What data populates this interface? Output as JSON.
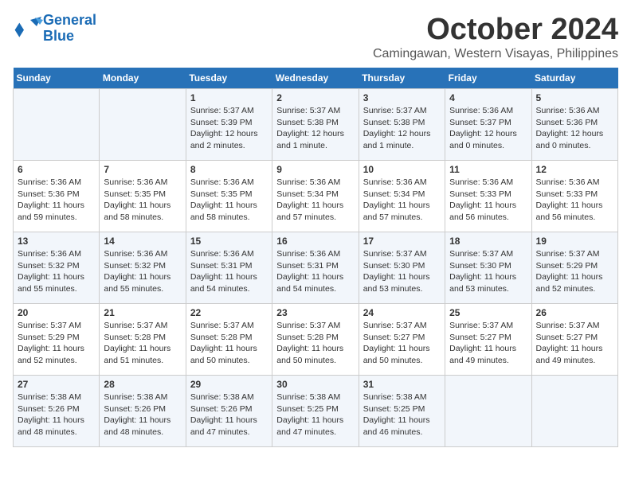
{
  "logo": {
    "line1": "General",
    "line2": "Blue"
  },
  "title": "October 2024",
  "subtitle": "Camingawan, Western Visayas, Philippines",
  "days_header": [
    "Sunday",
    "Monday",
    "Tuesday",
    "Wednesday",
    "Thursday",
    "Friday",
    "Saturday"
  ],
  "weeks": [
    [
      {
        "day": "",
        "info": ""
      },
      {
        "day": "",
        "info": ""
      },
      {
        "day": "1",
        "info": "Sunrise: 5:37 AM\nSunset: 5:39 PM\nDaylight: 12 hours\nand 2 minutes."
      },
      {
        "day": "2",
        "info": "Sunrise: 5:37 AM\nSunset: 5:38 PM\nDaylight: 12 hours\nand 1 minute."
      },
      {
        "day": "3",
        "info": "Sunrise: 5:37 AM\nSunset: 5:38 PM\nDaylight: 12 hours\nand 1 minute."
      },
      {
        "day": "4",
        "info": "Sunrise: 5:36 AM\nSunset: 5:37 PM\nDaylight: 12 hours\nand 0 minutes."
      },
      {
        "day": "5",
        "info": "Sunrise: 5:36 AM\nSunset: 5:36 PM\nDaylight: 12 hours\nand 0 minutes."
      }
    ],
    [
      {
        "day": "6",
        "info": "Sunrise: 5:36 AM\nSunset: 5:36 PM\nDaylight: 11 hours\nand 59 minutes."
      },
      {
        "day": "7",
        "info": "Sunrise: 5:36 AM\nSunset: 5:35 PM\nDaylight: 11 hours\nand 58 minutes."
      },
      {
        "day": "8",
        "info": "Sunrise: 5:36 AM\nSunset: 5:35 PM\nDaylight: 11 hours\nand 58 minutes."
      },
      {
        "day": "9",
        "info": "Sunrise: 5:36 AM\nSunset: 5:34 PM\nDaylight: 11 hours\nand 57 minutes."
      },
      {
        "day": "10",
        "info": "Sunrise: 5:36 AM\nSunset: 5:34 PM\nDaylight: 11 hours\nand 57 minutes."
      },
      {
        "day": "11",
        "info": "Sunrise: 5:36 AM\nSunset: 5:33 PM\nDaylight: 11 hours\nand 56 minutes."
      },
      {
        "day": "12",
        "info": "Sunrise: 5:36 AM\nSunset: 5:33 PM\nDaylight: 11 hours\nand 56 minutes."
      }
    ],
    [
      {
        "day": "13",
        "info": "Sunrise: 5:36 AM\nSunset: 5:32 PM\nDaylight: 11 hours\nand 55 minutes."
      },
      {
        "day": "14",
        "info": "Sunrise: 5:36 AM\nSunset: 5:32 PM\nDaylight: 11 hours\nand 55 minutes."
      },
      {
        "day": "15",
        "info": "Sunrise: 5:36 AM\nSunset: 5:31 PM\nDaylight: 11 hours\nand 54 minutes."
      },
      {
        "day": "16",
        "info": "Sunrise: 5:36 AM\nSunset: 5:31 PM\nDaylight: 11 hours\nand 54 minutes."
      },
      {
        "day": "17",
        "info": "Sunrise: 5:37 AM\nSunset: 5:30 PM\nDaylight: 11 hours\nand 53 minutes."
      },
      {
        "day": "18",
        "info": "Sunrise: 5:37 AM\nSunset: 5:30 PM\nDaylight: 11 hours\nand 53 minutes."
      },
      {
        "day": "19",
        "info": "Sunrise: 5:37 AM\nSunset: 5:29 PM\nDaylight: 11 hours\nand 52 minutes."
      }
    ],
    [
      {
        "day": "20",
        "info": "Sunrise: 5:37 AM\nSunset: 5:29 PM\nDaylight: 11 hours\nand 52 minutes."
      },
      {
        "day": "21",
        "info": "Sunrise: 5:37 AM\nSunset: 5:28 PM\nDaylight: 11 hours\nand 51 minutes."
      },
      {
        "day": "22",
        "info": "Sunrise: 5:37 AM\nSunset: 5:28 PM\nDaylight: 11 hours\nand 50 minutes."
      },
      {
        "day": "23",
        "info": "Sunrise: 5:37 AM\nSunset: 5:28 PM\nDaylight: 11 hours\nand 50 minutes."
      },
      {
        "day": "24",
        "info": "Sunrise: 5:37 AM\nSunset: 5:27 PM\nDaylight: 11 hours\nand 50 minutes."
      },
      {
        "day": "25",
        "info": "Sunrise: 5:37 AM\nSunset: 5:27 PM\nDaylight: 11 hours\nand 49 minutes."
      },
      {
        "day": "26",
        "info": "Sunrise: 5:37 AM\nSunset: 5:27 PM\nDaylight: 11 hours\nand 49 minutes."
      }
    ],
    [
      {
        "day": "27",
        "info": "Sunrise: 5:38 AM\nSunset: 5:26 PM\nDaylight: 11 hours\nand 48 minutes."
      },
      {
        "day": "28",
        "info": "Sunrise: 5:38 AM\nSunset: 5:26 PM\nDaylight: 11 hours\nand 48 minutes."
      },
      {
        "day": "29",
        "info": "Sunrise: 5:38 AM\nSunset: 5:26 PM\nDaylight: 11 hours\nand 47 minutes."
      },
      {
        "day": "30",
        "info": "Sunrise: 5:38 AM\nSunset: 5:25 PM\nDaylight: 11 hours\nand 47 minutes."
      },
      {
        "day": "31",
        "info": "Sunrise: 5:38 AM\nSunset: 5:25 PM\nDaylight: 11 hours\nand 46 minutes."
      },
      {
        "day": "",
        "info": ""
      },
      {
        "day": "",
        "info": ""
      }
    ]
  ]
}
